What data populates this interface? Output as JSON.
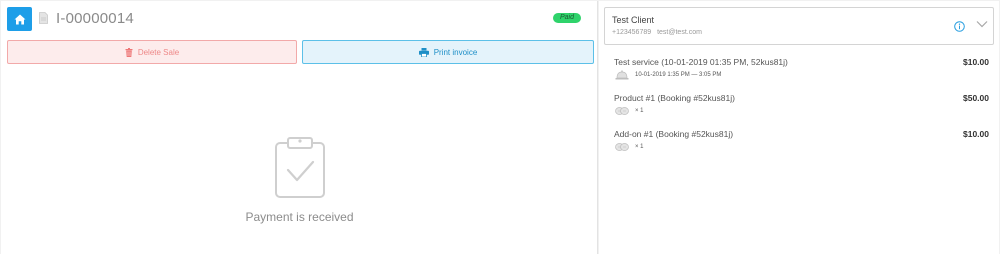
{
  "header": {
    "invoice_id": "I-00000014",
    "status_badge": "Paid"
  },
  "actions": {
    "delete_label": "Delete Sale",
    "print_label": "Print invoice"
  },
  "empty_state": {
    "message": "Payment is received"
  },
  "client": {
    "name": "Test Client",
    "phone": "+123456789",
    "email": "test@test.com"
  },
  "items": [
    {
      "title": "Test service (10-01-2019 01:35 PM, 52kus81j)",
      "price": "$10.00",
      "meta": "10-01-2019 1:35 PM — 3:05 PM",
      "icon": "service-bell-icon"
    },
    {
      "title": "Product #1 (Booking #52kus81j)",
      "price": "$50.00",
      "meta": "× 1",
      "icon": "product-boxes-icon"
    },
    {
      "title": "Add-on #1 (Booking #52kus81j)",
      "price": "$10.00",
      "meta": "× 1",
      "icon": "addon-boxes-icon"
    }
  ],
  "colors": {
    "accent": "#1e9ee8",
    "paid": "#2fd36b",
    "danger_bg": "#fdecec",
    "info_bg": "#e4f3fb"
  }
}
